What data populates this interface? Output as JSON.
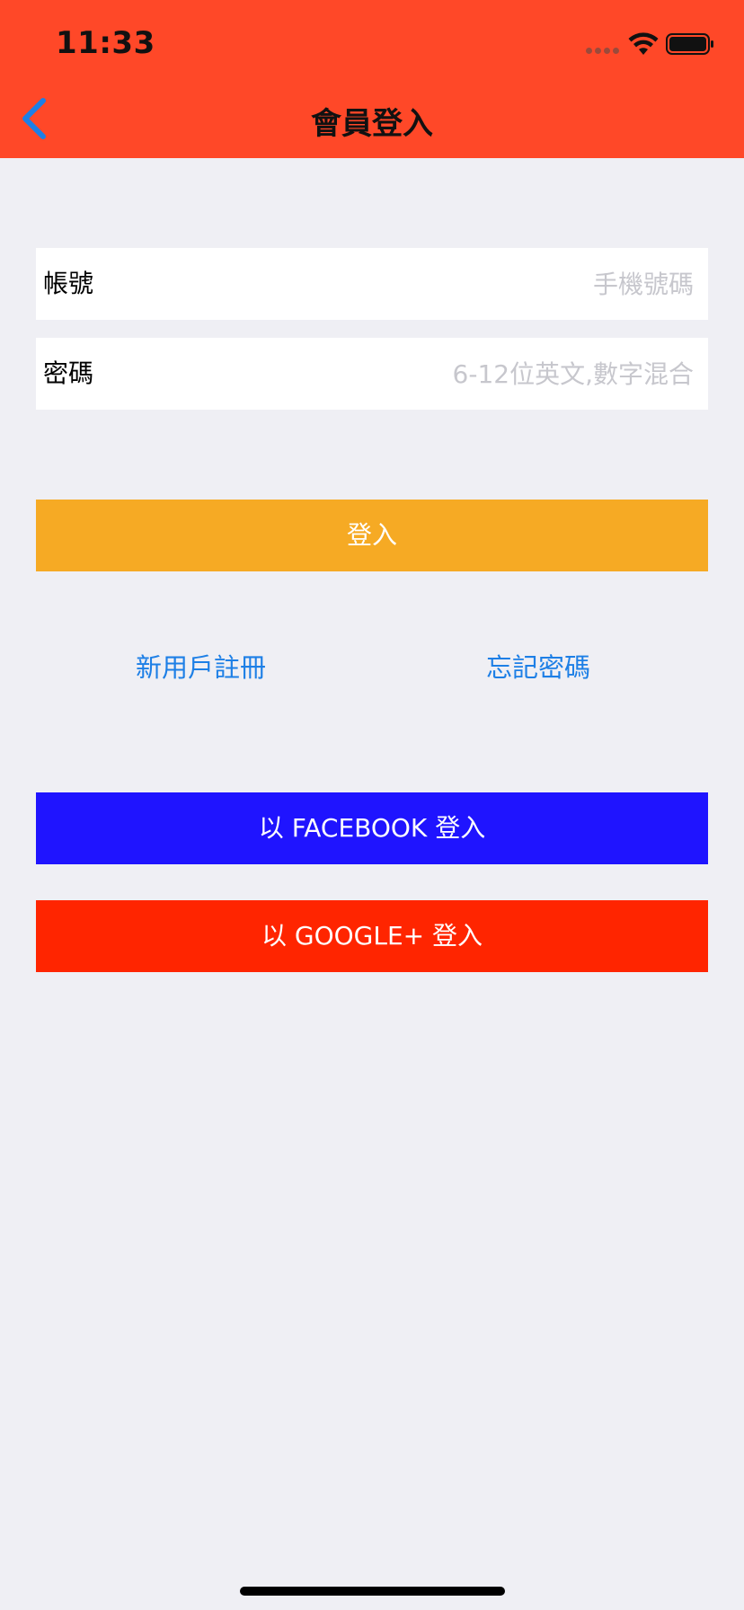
{
  "status_bar": {
    "time": "11:33",
    "icons": [
      "signal-dots-icon",
      "wifi-icon",
      "battery-icon"
    ]
  },
  "nav": {
    "back_icon": "chevron-left-icon",
    "title": "會員登入"
  },
  "form": {
    "account_label": "帳號",
    "account_placeholder": "手機號碼",
    "account_value": "",
    "password_label": "密碼",
    "password_placeholder": "6-12位英文,數字混合",
    "password_value": ""
  },
  "actions": {
    "login_label": "登入",
    "register_label": "新用戶註冊",
    "forgot_label": "忘記密碼",
    "facebook_label": "以 FACEBOOK 登入",
    "google_label": "以 GOOGLE+ 登入"
  },
  "colors": {
    "header": "#ff4828",
    "background": "#efeff4",
    "login_button": "#f6aa24",
    "facebook_button": "#1f14ff",
    "google_button": "#ff2500",
    "link": "#1d7fe6",
    "placeholder": "#c7c7cd"
  }
}
